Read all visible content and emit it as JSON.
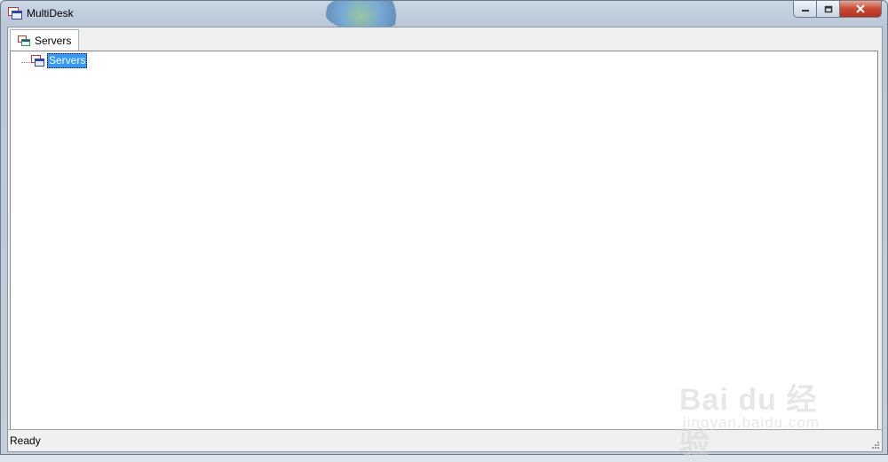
{
  "window": {
    "title": "MultiDesk"
  },
  "tabs": [
    {
      "label": "Servers",
      "icon": "servers-icon",
      "selected": true
    }
  ],
  "tree": {
    "nodes": [
      {
        "label": "Servers",
        "icon": "servers-icon",
        "selected": true
      }
    ]
  },
  "status": {
    "text": "Ready"
  },
  "watermark": {
    "brand": "Bai du 经验",
    "url": "jingyan.baidu.com"
  },
  "colors": {
    "selection": "#3399ff",
    "close_button": "#c74a35"
  }
}
